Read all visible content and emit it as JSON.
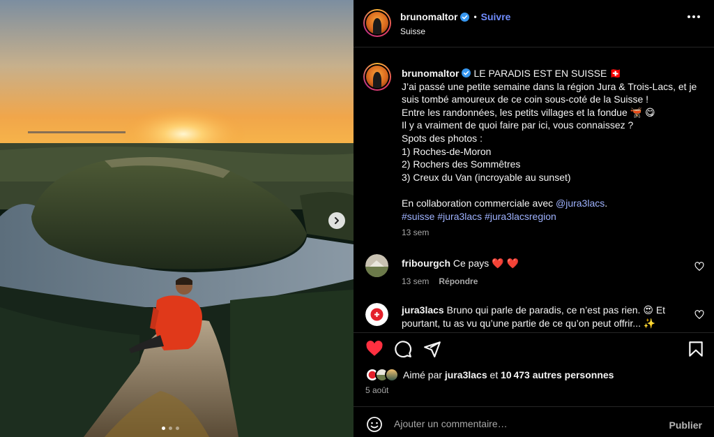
{
  "post": {
    "username": "brunomaltor",
    "follow_label": "Suivre",
    "separator": "•",
    "location": "Suisse",
    "more_icon": "more-horizontal-icon",
    "verified_color": "#3797f0"
  },
  "caption": {
    "username": "brunomaltor",
    "title": "LE PARADIS EST EN SUISSE 🇨🇭",
    "lines": [
      "J’ai passé une petite semaine dans la région Jura & Trois-Lacs, et je suis tombé amoureux de ce coin sous-coté de la Suisse !",
      "Entre les randonnées, les petits villages et la fondue 🫕 😋",
      "Il y a vraiment de quoi faire par ici, vous connaissez ?",
      "Spots des photos :",
      "1) Roches-de-Moron",
      "2) Rochers des Sommêtres",
      "3) Creux du Van (incroyable au sunset)"
    ],
    "collab_prefix": "En collaboration commerciale avec ",
    "collab_mention": "@jura3lacs",
    "collab_suffix": ".",
    "hashtags": "#suisse #jura3lacs #jura3lacsregion",
    "time": "13 sem"
  },
  "comments": [
    {
      "username": "fribourgch",
      "text": "Ce pays ❤️ ❤️",
      "time": "13 sem",
      "reply_label": "Répondre"
    },
    {
      "username": "jura3lacs",
      "text": "Bruno qui parle de paradis, ce n’est pas rien. 😍 Et pourtant, tu as vu qu’une partie de ce qu’on peut offrir... ✨"
    }
  ],
  "actions": {
    "icons": [
      "heart-filled-icon",
      "comment-icon",
      "share-icon",
      "bookmark-icon"
    ],
    "like_color": "#ff3040"
  },
  "likes": {
    "prefix": "Aimé par ",
    "user": "jura3lacs",
    "middle": " et ",
    "count": "10 473 autres personnes"
  },
  "date": "5 août",
  "add_comment": {
    "placeholder": "Ajouter un commentaire…",
    "publish_label": "Publier"
  },
  "carousel": {
    "total": 3,
    "active_index": 0
  }
}
